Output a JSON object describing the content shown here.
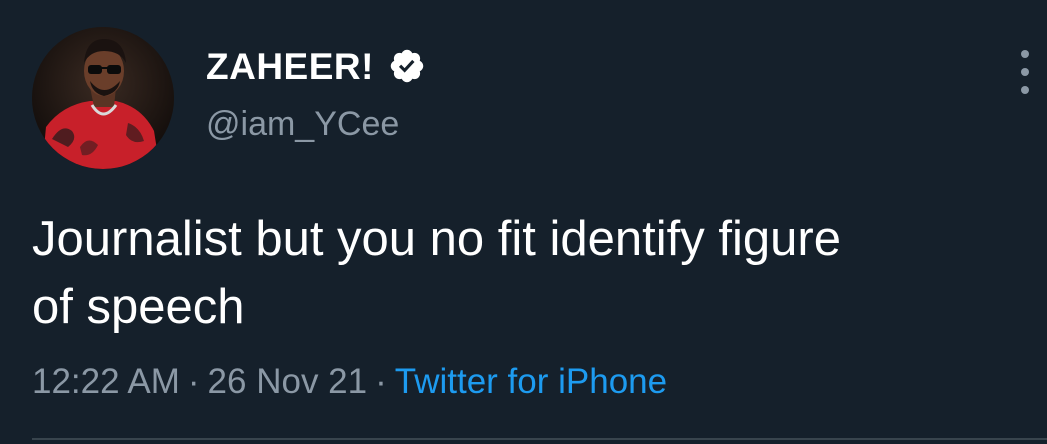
{
  "tweet": {
    "author": {
      "display_name": "ZAHEER!",
      "handle": "@iam_YCee",
      "verified": true,
      "avatar_icon": "profile-photo",
      "verified_icon": "verified-badge-icon"
    },
    "text": "Journalist but you no fit identify figure\nof speech",
    "time": "12:22 AM",
    "separator": "·",
    "date": "26 Nov 21",
    "source": "Twitter for iPhone",
    "more_icon": "more-options-icon"
  },
  "colors": {
    "background": "#15202b",
    "primary_text": "#ffffff",
    "secondary_text": "#8b98a5",
    "link": "#1d9bf0",
    "divider": "#38444d"
  }
}
